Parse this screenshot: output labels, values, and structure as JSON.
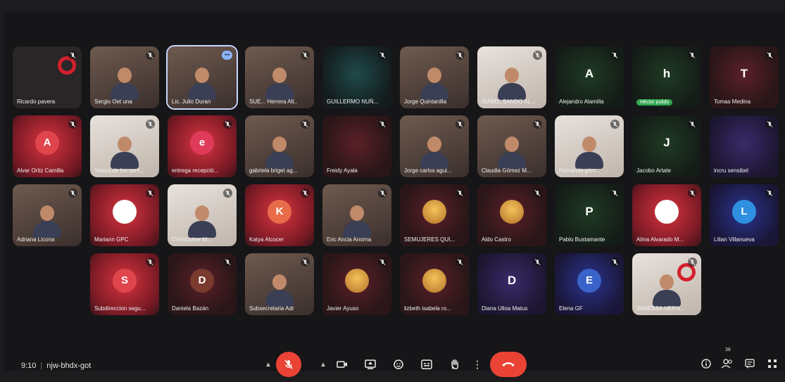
{
  "meeting": {
    "time": "9:10",
    "code": "njw-bhdx-got"
  },
  "participants_count": "38",
  "tiles": {
    "r0": [
      {
        "name": "Ricardo pavera",
        "kind": "logo"
      },
      {
        "name": "Sergio Oet una",
        "kind": "video"
      },
      {
        "name": "Lic. Julio Duran",
        "kind": "video",
        "speaking": true
      },
      {
        "name": "SUE... Herrera Alt..",
        "kind": "video"
      },
      {
        "name": "GUILLERMO NUÑ...",
        "kind": "teal"
      },
      {
        "name": "Jorge Quintanilla",
        "kind": "video"
      },
      {
        "name": "ISABEL SANDO AL...",
        "kind": "bright"
      },
      {
        "name": "Alejandro Alamilla",
        "kind": "green",
        "initial": "A"
      },
      {
        "name": "Héctor pulido",
        "kind": "green",
        "initial": "h",
        "tag": true
      },
      {
        "name": "Tomas Medina",
        "kind": "darkred",
        "initial": "T"
      }
    ],
    "r1": [
      {
        "name": "Alvar Ortiz Camilla",
        "kind": "red",
        "initial": "A",
        "avatar": "red"
      },
      {
        "name": "Yesica de los sant...",
        "kind": "bright"
      },
      {
        "name": "entrega recepció...",
        "kind": "red",
        "initial": "e",
        "avatar": "pink"
      },
      {
        "name": "gabriela briget ag...",
        "kind": "video"
      },
      {
        "name": "Freidy Ayala",
        "kind": "darkred"
      },
      {
        "name": "Jorge carlos agui...",
        "kind": "video"
      },
      {
        "name": "Claudia Gómez M...",
        "kind": "video"
      },
      {
        "name": "Fernanda góm...",
        "kind": "bright"
      },
      {
        "name": "Jacobo Artate",
        "kind": "green",
        "initial": "J"
      },
      {
        "name": "incru sensibel",
        "kind": "purple"
      }
    ],
    "r2": [
      {
        "name": "Adriana Licona",
        "kind": "video"
      },
      {
        "name": "Mariann GPC",
        "kind": "red",
        "avatar": "logo"
      },
      {
        "name": "Christopher M...",
        "kind": "bright"
      },
      {
        "name": "Katya Alcocer",
        "kind": "red",
        "initial": "K",
        "avatar": "orange"
      },
      {
        "name": "Eric Ancia Anorna",
        "kind": "video"
      },
      {
        "name": "SEMUJERES QUI...",
        "kind": "darkred",
        "avatar": "img"
      },
      {
        "name": "Aldo Castro",
        "kind": "darkred",
        "avatar": "img"
      },
      {
        "name": "Pablo Bustamante",
        "kind": "green",
        "initial": "P"
      },
      {
        "name": "Alma Alvarado M...",
        "kind": "red",
        "avatar": "logo"
      },
      {
        "name": "Lilian Villanueva",
        "kind": "blue",
        "initial": "L",
        "avatar": "lblue"
      }
    ],
    "r3": [
      {
        "name": "Subdireccion segu...",
        "kind": "red",
        "initial": "S",
        "avatar": "red"
      },
      {
        "name": "Daniela Bazán",
        "kind": "darkred",
        "initial": "D",
        "avatar": "brown"
      },
      {
        "name": "Subsecretaria Adr",
        "kind": "video"
      },
      {
        "name": "Javier Ayuso",
        "kind": "darkred",
        "avatar": "img"
      },
      {
        "name": "lizbeth isabela ro...",
        "kind": "darkred",
        "avatar": "img"
      },
      {
        "name": "Diana Ulloa Matus",
        "kind": "purple",
        "initial": "D"
      },
      {
        "name": "Elena GF",
        "kind": "blue",
        "initial": "E",
        "avatar": "blue"
      },
      {
        "name": "VANESSA HERN...",
        "kind": "bright",
        "logo": true
      }
    ]
  },
  "colors": {
    "accent": "#8ab4f8",
    "hangup": "#ea4335",
    "background": "#161517"
  },
  "icons": [
    "mic-off-icon",
    "camera-icon",
    "present-icon",
    "emoji-icon",
    "captions-icon",
    "hand-icon",
    "more-icon",
    "hangup-icon",
    "info-icon",
    "people-icon",
    "chat-icon",
    "activities-icon"
  ]
}
